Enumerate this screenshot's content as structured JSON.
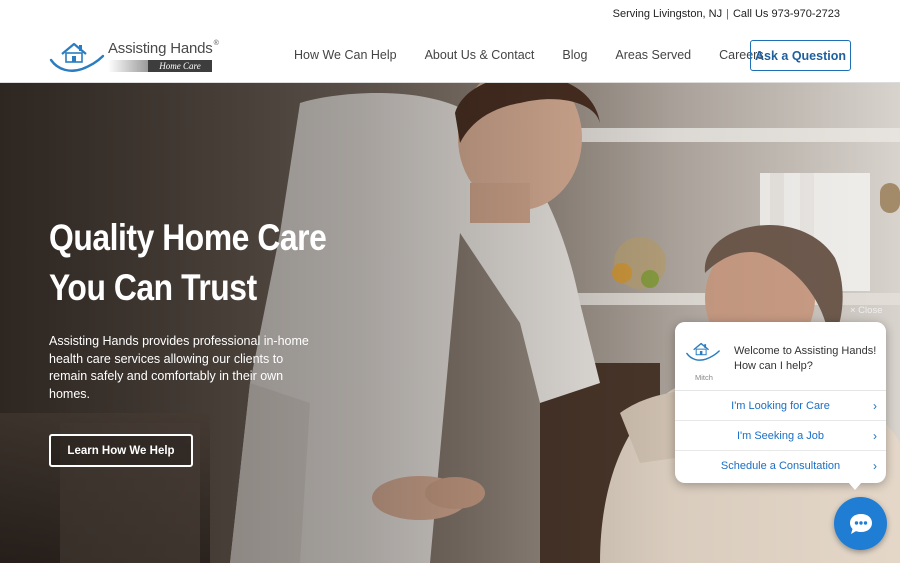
{
  "header": {
    "topbar": {
      "serving": "Serving Livingston, NJ",
      "separator": "|",
      "call": "Call Us 973-970-2723"
    },
    "logo": {
      "name": "Assisting Hands",
      "registered": "®",
      "subtitle": "Home Care",
      "icon": "house-hands-icon"
    },
    "nav": [
      {
        "label": "How We Can Help"
      },
      {
        "label": "About Us & Contact"
      },
      {
        "label": "Blog"
      },
      {
        "label": "Areas Served"
      },
      {
        "label": "Careers"
      }
    ],
    "cta_label": "Ask a Question",
    "colors": {
      "accent": "#1f6fb5"
    }
  },
  "hero": {
    "title_line1": "Quality Home Care",
    "title_line2": "You Can Trust",
    "text": "Assisting Hands provides professional in-home health care services allowing our clients to remain safely and comfortably in their own homes.",
    "button_label": "Learn How We Help"
  },
  "chat": {
    "close_label": "× Close",
    "agent_name": "Mitch",
    "avatar_icon": "house-hands-icon",
    "message": "Welcome to Assisting Hands! How can I help?",
    "options": [
      {
        "label": "I'm Looking for Care",
        "icon": "chevron-right-icon"
      },
      {
        "label": "I'm Seeking a Job",
        "icon": "chevron-right-icon"
      },
      {
        "label": "Schedule a Consultation",
        "icon": "chevron-right-icon"
      }
    ],
    "fab_icon": "chat-bubble-icon",
    "colors": {
      "link": "#1a6fc4",
      "fab": "#1f7ed3"
    }
  }
}
